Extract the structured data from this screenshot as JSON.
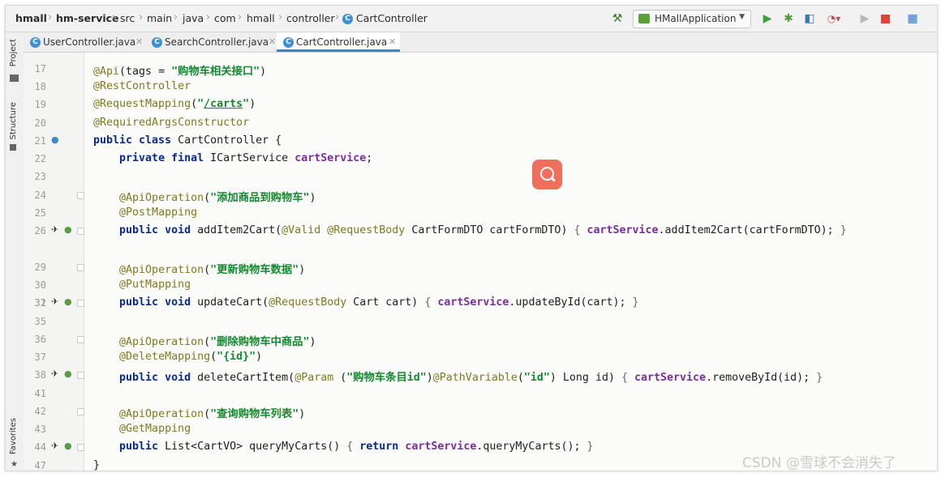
{
  "breadcrumb": [
    "hmall",
    "hm-service",
    "src",
    "main",
    "java",
    "com",
    "hmall",
    "controller",
    "CartController"
  ],
  "run_config": {
    "label": "HMallApplication"
  },
  "tabs": [
    {
      "label": "UserController.java",
      "active": false
    },
    {
      "label": "SearchController.java",
      "active": false
    },
    {
      "label": "CartController.java",
      "active": true
    }
  ],
  "side_tools": {
    "project": "Project",
    "structure": "Structure",
    "favorites": "Favorites"
  },
  "line_numbers": [
    "17",
    "18",
    "19",
    "20",
    "21",
    "22",
    "23",
    "24",
    "25",
    "26",
    "29",
    "30",
    "31",
    "32",
    "35",
    "36",
    "37",
    "38",
    "41",
    "42",
    "43",
    "44",
    "47"
  ],
  "code": {
    "l17": {
      "ann": "@Api",
      "a": "(tags = ",
      "s": "\"购物车相关接口\"",
      "b": ")"
    },
    "l18": "@RestController",
    "l19": {
      "ann": "@RequestMapping",
      "p1": "(",
      "q1": "\"",
      "u": "/carts",
      "q2": "\"",
      "p2": ")"
    },
    "l20": "@RequiredArgsConstructor",
    "l21": {
      "k1": "public class",
      "rest": " CartController {"
    },
    "l22": {
      "k1": "private final",
      "t": " ICartService ",
      "f": "cartService",
      "e": ";"
    },
    "l24": {
      "ann": "@ApiOperation",
      "p1": "(",
      "s": "\"添加商品到购物车\"",
      "p2": ")"
    },
    "l25": "@PostMapping",
    "l26": {
      "k": "public void",
      "m": " addItem2Cart(",
      "a1": "@Valid",
      "sp": " ",
      "a2": "@RequestBody",
      "p": " CartFormDTO cartFormDTO) ",
      "b1": "{",
      "f": " cartService",
      "c": ".addItem2Cart(cartFormDTO);",
      "b2": " }"
    },
    "l30": {
      "ann": "@ApiOperation",
      "p1": "(",
      "s": "\"更新购物车数据\"",
      "p2": ")"
    },
    "l31": "@PutMapping",
    "l32": {
      "k": "public void",
      "m": " updateCart(",
      "a1": "@RequestBody",
      "p": " Cart cart) ",
      "b1": "{",
      "f": " cartService",
      "c": ".updateById(cart);",
      "b2": " }"
    },
    "l36": {
      "ann": "@ApiOperation",
      "p1": "(",
      "s": "\"删除购物车中商品\"",
      "p2": ")"
    },
    "l37": {
      "ann": "@DeleteMapping",
      "p1": "(",
      "s": "\"{id}\"",
      "p2": ")"
    },
    "l38": {
      "k": "public void",
      "m": " deleteCartItem(",
      "a1": "@Param",
      "p1": " (",
      "s1": "\"购物车条目id\"",
      "p2": ")",
      "a2": "@PathVariable",
      "p3": "(",
      "s2": "\"id\"",
      "p4": ") Long id) ",
      "b1": "{",
      "f": " cartService",
      "c": ".removeById(id);",
      "b2": " }"
    },
    "l42": {
      "ann": "@ApiOperation",
      "p1": "(",
      "s": "\"查询购物车列表\"",
      "p2": ")"
    },
    "l43": "@GetMapping",
    "l44": {
      "k": "public",
      "t": " List<CartVO> queryMyCarts() ",
      "b1": "{",
      "r": " return",
      "f": " cartService",
      "c": ".queryMyCarts();",
      "b2": " }"
    },
    "l47": "}"
  },
  "watermark": "CSDN @雪球不会消失了",
  "colors": {
    "keyword": "#0a2a8c",
    "annotation": "#7f7a1f",
    "string": "#148a30",
    "field": "#7a2f9c",
    "search_button": "#f06e5c"
  },
  "icons": [
    "build-hammer-icon",
    "run-icon",
    "debug-icon",
    "coverage-icon",
    "profile-icon",
    "stop-icon",
    "project-structure-icon",
    "class-icon",
    "spring-bean-icon",
    "request-mapping-icon",
    "search-icon"
  ]
}
